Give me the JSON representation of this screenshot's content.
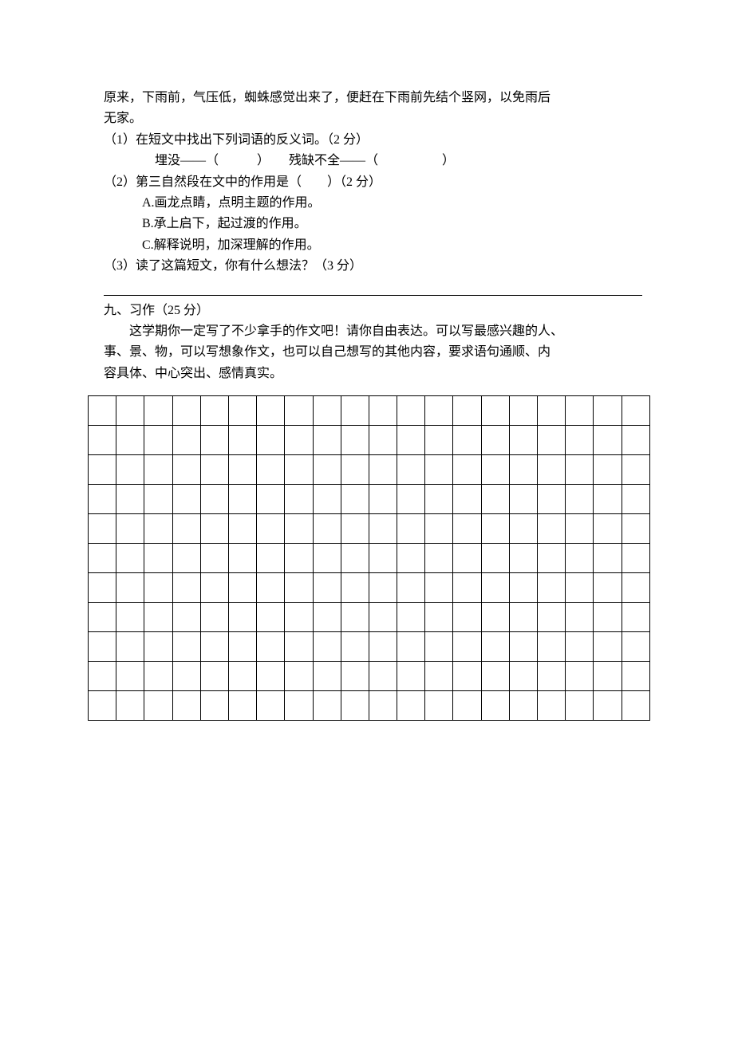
{
  "passage": {
    "l1": "原来，下雨前，气压低，蜘蛛感觉出来了，便赶在下雨前先结个竖网，以免雨后",
    "l2": "无家。"
  },
  "q1": {
    "label": "（1）在短文中找出下列词语的反义词。（2 分）",
    "line": "埋没——（　　　）　　残缺不全——（　　　　　）"
  },
  "q2": {
    "label": "（2）第三自然段在文中的作用是（　　）（2 分）",
    "optA": "A.画龙点睛，点明主题的作用。",
    "optB": "B.承上启下，起过渡的作用。",
    "optC": "C.解释说明，加深理解的作用。"
  },
  "q3": {
    "label": "（3）读了这篇短文，你有什么想法？（3 分）"
  },
  "section9": {
    "title": "九、习作（25 分）",
    "prompt_l1": "这学期你一定写了不少拿手的作文吧！请你自由表达。可以写最感兴趣的人、",
    "prompt_l2": "事、景、物，可以写想象作文，也可以自己想写的其他内容，要求语句通顺、内",
    "prompt_l3": "容具体、中心突出、感情真实。"
  },
  "grid": {
    "cols": 20,
    "rows": 11
  }
}
